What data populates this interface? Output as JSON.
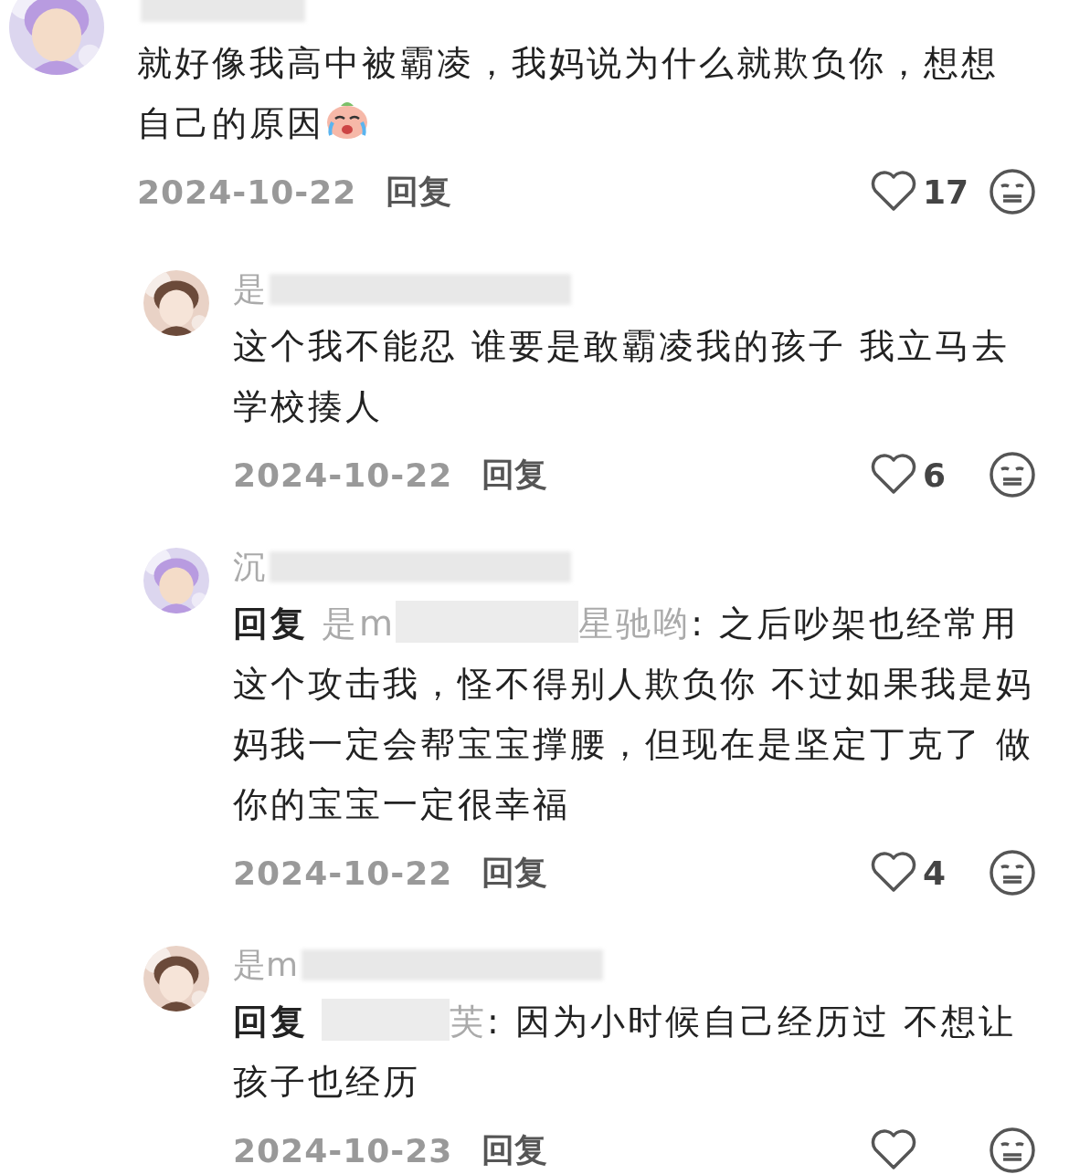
{
  "comments": [
    {
      "kind": "top",
      "author_redacted": true,
      "text": "就好像我高中被霸凌，我妈说为什么就欺负你，想想自己的原因",
      "trailing_emoji": {
        "kind": "crying"
      },
      "date": "2024-10-22",
      "reply_button": "回复",
      "likes": "17"
    },
    {
      "kind": "reply",
      "author": "是",
      "author_redacted": true,
      "text": "这个我不能忍 谁要是敢霸凌我的孩子 我立马去学校揍人",
      "date": "2024-10-22",
      "reply_button": "回复",
      "likes": "6"
    },
    {
      "kind": "reply",
      "author": "沉",
      "author_redacted": true,
      "reply_to": {
        "label": "回复",
        "name_start": "是m",
        "name_end": "星驰哟",
        "separator": ":"
      },
      "text": "之后吵架也经常用这个攻击我，怪不得别人欺负你 不过如果我是妈妈我一定会帮宝宝撑腰，但现在是坚定丁克了 做你的宝宝一定很幸福",
      "date": "2024-10-22",
      "reply_button": "回复",
      "likes": "4"
    },
    {
      "kind": "reply",
      "author": "是m",
      "author_redacted": true,
      "reply_to": {
        "label": "回复",
        "name_end": "芙",
        "separator": ":"
      },
      "text": "因为小时候自己经历过 不想让孩子也经历",
      "date": "2024-10-23",
      "reply_button": "回复"
    }
  ]
}
